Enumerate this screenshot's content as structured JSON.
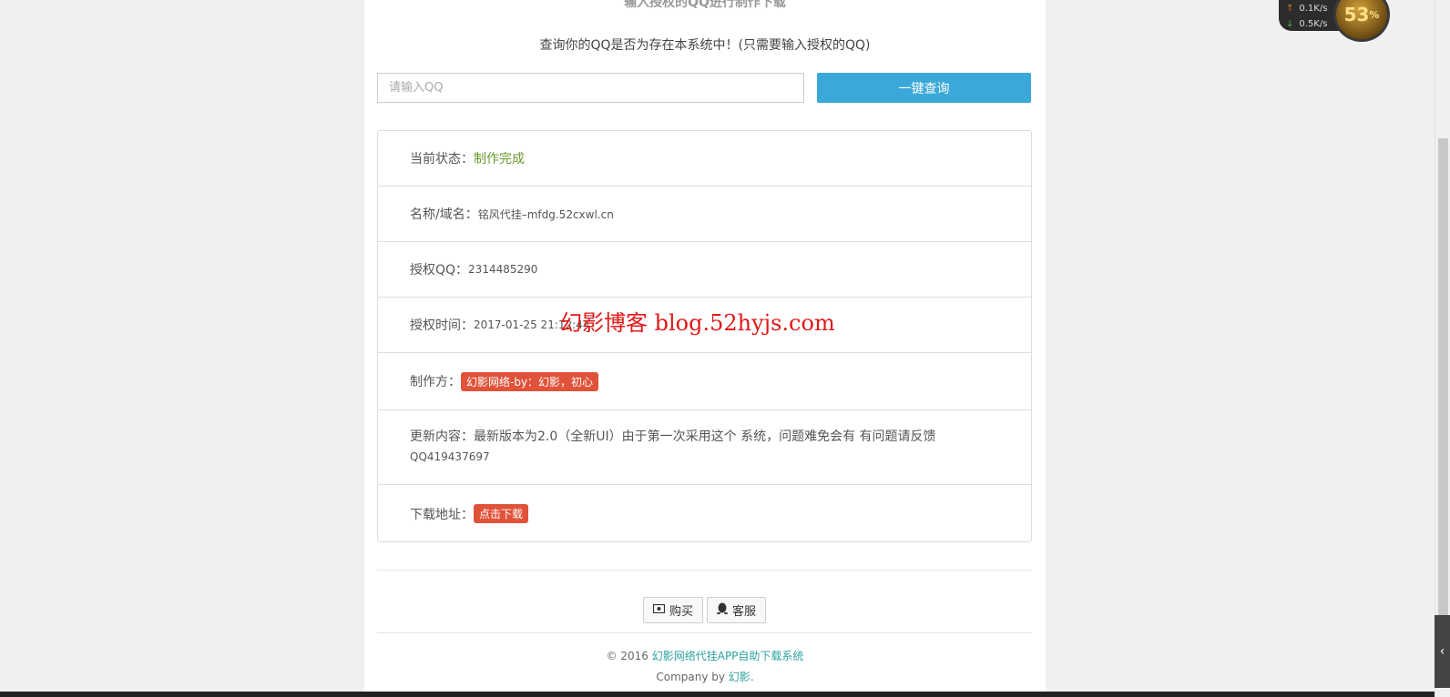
{
  "header": {
    "top_title": "输入授权的QQ进行制作下载",
    "subtitle": "查询你的QQ是否为存在本系统中！(只需要输入授权的QQ)"
  },
  "search": {
    "placeholder": "请输入QQ",
    "value": "",
    "button_label": "一键查询"
  },
  "info": {
    "status_label": "当前状态：",
    "status_value": "制作完成",
    "name_label": "名称/域名：",
    "name_value": "铭风代挂–mfdg.52cxwl.cn",
    "qq_label": "授权QQ：",
    "qq_value": "2314485290",
    "time_label": "授权时间：",
    "time_value": "2017-01-25 21:12:44",
    "maker_label": "制作方：",
    "maker_value": "幻影网络-by：幻影，初心",
    "update_label": "更新内容：",
    "update_line1": "最新版本为2.0（全新UI）由于第一次采用这个 系统，问题难免会有 有问题请反馈",
    "update_line2": "QQ419437697",
    "download_label": "下载地址：",
    "download_button": "点击下载"
  },
  "actions": {
    "buy_label": "购买",
    "service_label": "客服"
  },
  "footer": {
    "copyright_prefix": "© 2016 ",
    "system_name": "幻影网络代挂APP自助下载系统",
    "company_prefix": "Company by ",
    "company_name": "幻影",
    "company_suffix": "."
  },
  "watermark": {
    "text": "幻影博客 blog.52hyjs.com"
  },
  "net_widget": {
    "upload": "0.1K/s",
    "download": "0.5K/s",
    "percent": "53",
    "percent_sign": "%"
  },
  "colors": {
    "primary_button": "#3aa8d8",
    "status_green": "#6a9a2e",
    "tag_red": "#e0533a",
    "link_teal": "#2ea0a0",
    "watermark_red": "#e01818"
  },
  "icons": {
    "buy": "money-icon",
    "service": "qq-penguin-icon",
    "scroll_side": "chevron-left-icon"
  }
}
